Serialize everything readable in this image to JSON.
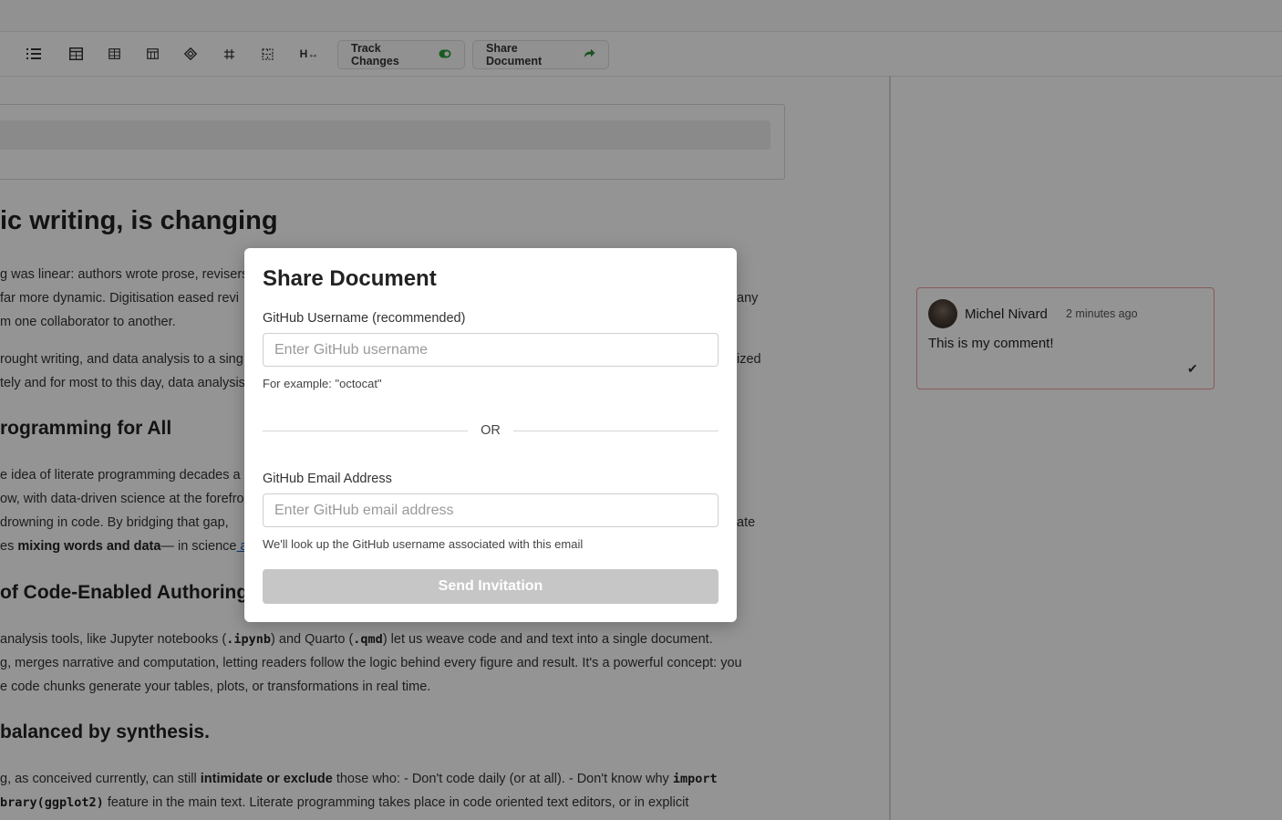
{
  "toolbar": {
    "icons": [
      "numbered-list-icon",
      "table-icon",
      "table-add-row-icon",
      "table-add-column-icon",
      "diamond-icon",
      "merge-cells-icon",
      "split-cells-icon"
    ],
    "header_toggle_label": "H↔",
    "track_changes_label": "Track Changes",
    "share_document_label": "Share Document"
  },
  "document": {
    "heading1": "ic writing, is changing",
    "p1": {
      "l1": "g was linear: authors wrote prose, revisers",
      "l2a": "far more dynamic. Digitisation eased revi",
      "l2b": "any",
      "l3": "m one collaborator to another."
    },
    "p2": {
      "l1a": "rought writing, and data analysis to a sing",
      "l1b": "ized",
      "l2": "tely and for most to this day, data analysis"
    },
    "heading2": "rogramming for All",
    "p3": {
      "l1": "e idea of literate programming decades a",
      "l2": "ow, with data-driven science at the forefro",
      "l3a": "drowning in code. By bridging that gap,",
      "l3b": "ate",
      "l4_pre": "es ",
      "l4_bold": "mixing words and data",
      "l4_post": "— in science",
      "l4_link": " a"
    },
    "heading3": "of Code-Enabled Authoring",
    "p4": {
      "l1_pre": " analysis tools, like Jupyter notebooks (",
      "l1_code1": ".ipynb",
      "l1_mid": ") and Quarto (",
      "l1_code2": ".qmd",
      "l1_post": ") let us weave code and and text into a single document.",
      "l2": "g, merges narrative and computation, letting readers follow the logic behind every figure and result. It's a powerful concept: you",
      "l3": "e code chunks generate your tables, plots, or transformations in real time."
    },
    "heading4": "balanced by synthesis.",
    "p5": {
      "l1_pre": "g, as conceived currently, can still ",
      "l1_bold": "intimidate or exclude",
      "l1_post": " those who: - Don't code daily (or at all). - Don't know why ",
      "l1_code": "import",
      "l2_code": "brary(ggplot2)",
      "l2_post": " feature in the main text. Literate programming takes place in code oriented text editors, or in explicit"
    }
  },
  "comment": {
    "author": "Michel Nivard",
    "time": "2 minutes ago",
    "text": "This is my comment!"
  },
  "modal": {
    "title": "Share Document",
    "username_label": "GitHub Username (recommended)",
    "username_placeholder": "Enter GitHub username",
    "username_hint": "For example: \"octocat\"",
    "or_label": "OR",
    "email_label": "GitHub Email Address",
    "email_placeholder": "Enter GitHub email address",
    "email_hint": "We'll look up the GitHub username associated with this email",
    "send_label": "Send Invitation"
  },
  "colors": {
    "overlay": "#000000",
    "toggle_on": "#2e9e3a",
    "share_arrow": "#2e8b3a",
    "comment_border": "#e89b9b",
    "send_disabled": "#c6c6c6"
  }
}
